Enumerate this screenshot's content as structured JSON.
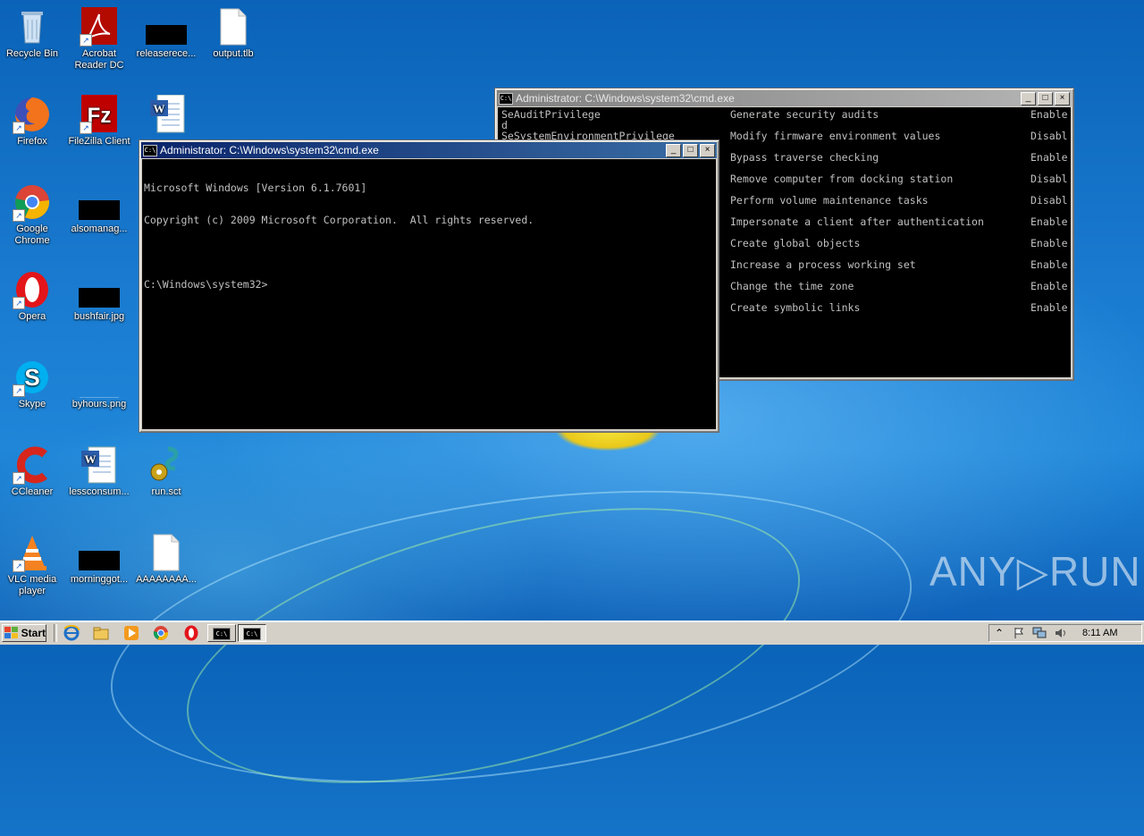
{
  "desktop": {
    "icons": [
      {
        "label": "Recycle Bin",
        "icon": "recycle-bin-icon"
      },
      {
        "label": "Acrobat\nReader DC",
        "icon": "acrobat-icon"
      },
      {
        "label": "releaserece...",
        "icon": "black-thumbnail-icon"
      },
      {
        "label": "output.tlb",
        "icon": "file-icon"
      },
      {
        "label": "Firefox",
        "icon": "firefox-icon"
      },
      {
        "label": "FileZilla Client",
        "icon": "filezilla-icon"
      },
      {
        "label": "",
        "icon": "word-doc-icon"
      },
      {
        "label": "Google\nChrome",
        "icon": "chrome-icon"
      },
      {
        "label": "alsomanag...",
        "icon": "black-thumbnail-icon"
      },
      {
        "label": "Opera",
        "icon": "opera-icon"
      },
      {
        "label": "bushfair.jpg",
        "icon": "image-thumbnail-icon"
      },
      {
        "label": "Skype",
        "icon": "skype-icon"
      },
      {
        "label": "byhours.png",
        "icon": "image-thumbnail-icon"
      },
      {
        "label": "CCleaner",
        "icon": "ccleaner-icon"
      },
      {
        "label": "lessconsum...",
        "icon": "word-doc-icon"
      },
      {
        "label": "run.sct",
        "icon": "script-icon"
      },
      {
        "label": "VLC media\nplayer",
        "icon": "vlc-icon"
      },
      {
        "label": "morninggot...",
        "icon": "black-thumbnail-icon"
      },
      {
        "label": "AAAAAAAA...",
        "icon": "file-icon"
      }
    ]
  },
  "cmd_back": {
    "title": "Administrator: C:\\Windows\\system32\\cmd.exe",
    "rows": [
      {
        "name": "SeAuditPrivilege",
        "desc": "Generate security audits",
        "state": "Enable"
      },
      {
        "name": "SeSystemEnvironmentPrivilege",
        "desc": "Modify firmware environment values",
        "state": "Disabl"
      },
      {
        "name": "d",
        "desc": "Bypass traverse checking",
        "state": "Enable"
      },
      {
        "name": "",
        "desc": "Remove computer from docking station",
        "state": "Disabl"
      },
      {
        "name": "",
        "desc": "Perform volume maintenance tasks",
        "state": "Disabl"
      },
      {
        "name": "",
        "desc": "Impersonate a client after authentication",
        "state": "Enable"
      },
      {
        "name": "",
        "desc": "Create global objects",
        "state": "Enable"
      },
      {
        "name": "",
        "desc": "Increase a process working set",
        "state": "Enable"
      },
      {
        "name": "",
        "desc": "Change the time zone",
        "state": "Enable"
      },
      {
        "name": "",
        "desc": "Create symbolic links",
        "state": "Enable"
      }
    ]
  },
  "cmd_front": {
    "title": "Administrator: C:\\Windows\\system32\\cmd.exe",
    "lines": [
      "Microsoft Windows [Version 6.1.7601]",
      "Copyright (c) 2009 Microsoft Corporation.  All rights reserved.",
      "",
      "C:\\Windows\\system32>"
    ]
  },
  "window_buttons": {
    "minimize": "_",
    "maximize": "□",
    "close": "×"
  },
  "taskbar": {
    "start_label": "Start",
    "clock": "8:11 AM",
    "tray_expand": "⌃"
  },
  "watermark": "ANY▷RUN",
  "colors": {
    "titlebar_active": "#0a246a",
    "console_bg": "#000000",
    "console_fg": "#c0c0c0"
  }
}
